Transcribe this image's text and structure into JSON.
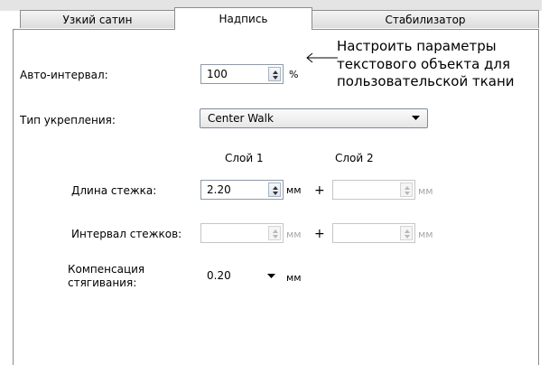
{
  "tabs": [
    {
      "label": "Узкий сатин",
      "active": false
    },
    {
      "label": "Надпись",
      "active": true
    },
    {
      "label": "Стабилизатор",
      "active": false
    }
  ],
  "callout": {
    "lines": [
      "Настроить параметры",
      "текстового объекта для",
      "пользовательской ткани"
    ]
  },
  "auto_spacing": {
    "label": "Авто-интервал:",
    "value": "100",
    "unit": "%"
  },
  "underlay_type": {
    "label": "Тип укрепления:",
    "value": "Center Walk"
  },
  "layers": {
    "layer1": "Слой 1",
    "layer2": "Слой 2"
  },
  "stitch_length": {
    "label": "Длина стежка:",
    "layer1_value": "2.20",
    "layer1_unit": "мм",
    "plus": "+",
    "layer2_value": "",
    "layer2_unit": "мм"
  },
  "stitch_spacing": {
    "label": "Интервал стежков:",
    "layer1_value": "",
    "layer1_unit": "мм",
    "plus": "+",
    "layer2_value": "",
    "layer2_unit": "мм"
  },
  "pull_comp": {
    "label_line1": "Компенсация",
    "label_line2": "стягивания:",
    "value": "0.20",
    "unit": "мм"
  },
  "colors": {
    "border": "#8c8c8c",
    "disabled_text": "#a8a8a8"
  }
}
